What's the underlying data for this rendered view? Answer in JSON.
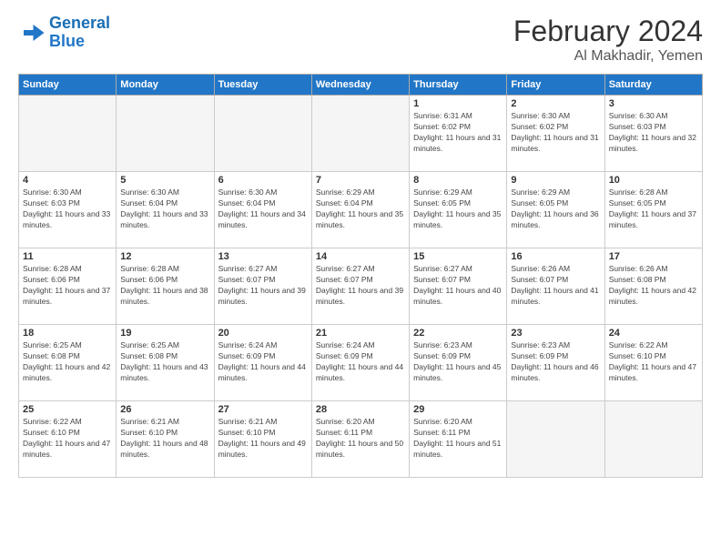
{
  "logo": {
    "line1": "General",
    "line2": "Blue"
  },
  "title": "February 2024",
  "subtitle": "Al Makhadir, Yemen",
  "days_of_week": [
    "Sunday",
    "Monday",
    "Tuesday",
    "Wednesday",
    "Thursday",
    "Friday",
    "Saturday"
  ],
  "weeks": [
    [
      {
        "day": "",
        "info": ""
      },
      {
        "day": "",
        "info": ""
      },
      {
        "day": "",
        "info": ""
      },
      {
        "day": "",
        "info": ""
      },
      {
        "day": "1",
        "info": "Sunrise: 6:31 AM\nSunset: 6:02 PM\nDaylight: 11 hours and 31 minutes."
      },
      {
        "day": "2",
        "info": "Sunrise: 6:30 AM\nSunset: 6:02 PM\nDaylight: 11 hours and 31 minutes."
      },
      {
        "day": "3",
        "info": "Sunrise: 6:30 AM\nSunset: 6:03 PM\nDaylight: 11 hours and 32 minutes."
      }
    ],
    [
      {
        "day": "4",
        "info": "Sunrise: 6:30 AM\nSunset: 6:03 PM\nDaylight: 11 hours and 33 minutes."
      },
      {
        "day": "5",
        "info": "Sunrise: 6:30 AM\nSunset: 6:04 PM\nDaylight: 11 hours and 33 minutes."
      },
      {
        "day": "6",
        "info": "Sunrise: 6:30 AM\nSunset: 6:04 PM\nDaylight: 11 hours and 34 minutes."
      },
      {
        "day": "7",
        "info": "Sunrise: 6:29 AM\nSunset: 6:04 PM\nDaylight: 11 hours and 35 minutes."
      },
      {
        "day": "8",
        "info": "Sunrise: 6:29 AM\nSunset: 6:05 PM\nDaylight: 11 hours and 35 minutes."
      },
      {
        "day": "9",
        "info": "Sunrise: 6:29 AM\nSunset: 6:05 PM\nDaylight: 11 hours and 36 minutes."
      },
      {
        "day": "10",
        "info": "Sunrise: 6:28 AM\nSunset: 6:05 PM\nDaylight: 11 hours and 37 minutes."
      }
    ],
    [
      {
        "day": "11",
        "info": "Sunrise: 6:28 AM\nSunset: 6:06 PM\nDaylight: 11 hours and 37 minutes."
      },
      {
        "day": "12",
        "info": "Sunrise: 6:28 AM\nSunset: 6:06 PM\nDaylight: 11 hours and 38 minutes."
      },
      {
        "day": "13",
        "info": "Sunrise: 6:27 AM\nSunset: 6:07 PM\nDaylight: 11 hours and 39 minutes."
      },
      {
        "day": "14",
        "info": "Sunrise: 6:27 AM\nSunset: 6:07 PM\nDaylight: 11 hours and 39 minutes."
      },
      {
        "day": "15",
        "info": "Sunrise: 6:27 AM\nSunset: 6:07 PM\nDaylight: 11 hours and 40 minutes."
      },
      {
        "day": "16",
        "info": "Sunrise: 6:26 AM\nSunset: 6:07 PM\nDaylight: 11 hours and 41 minutes."
      },
      {
        "day": "17",
        "info": "Sunrise: 6:26 AM\nSunset: 6:08 PM\nDaylight: 11 hours and 42 minutes."
      }
    ],
    [
      {
        "day": "18",
        "info": "Sunrise: 6:25 AM\nSunset: 6:08 PM\nDaylight: 11 hours and 42 minutes."
      },
      {
        "day": "19",
        "info": "Sunrise: 6:25 AM\nSunset: 6:08 PM\nDaylight: 11 hours and 43 minutes."
      },
      {
        "day": "20",
        "info": "Sunrise: 6:24 AM\nSunset: 6:09 PM\nDaylight: 11 hours and 44 minutes."
      },
      {
        "day": "21",
        "info": "Sunrise: 6:24 AM\nSunset: 6:09 PM\nDaylight: 11 hours and 44 minutes."
      },
      {
        "day": "22",
        "info": "Sunrise: 6:23 AM\nSunset: 6:09 PM\nDaylight: 11 hours and 45 minutes."
      },
      {
        "day": "23",
        "info": "Sunrise: 6:23 AM\nSunset: 6:09 PM\nDaylight: 11 hours and 46 minutes."
      },
      {
        "day": "24",
        "info": "Sunrise: 6:22 AM\nSunset: 6:10 PM\nDaylight: 11 hours and 47 minutes."
      }
    ],
    [
      {
        "day": "25",
        "info": "Sunrise: 6:22 AM\nSunset: 6:10 PM\nDaylight: 11 hours and 47 minutes."
      },
      {
        "day": "26",
        "info": "Sunrise: 6:21 AM\nSunset: 6:10 PM\nDaylight: 11 hours and 48 minutes."
      },
      {
        "day": "27",
        "info": "Sunrise: 6:21 AM\nSunset: 6:10 PM\nDaylight: 11 hours and 49 minutes."
      },
      {
        "day": "28",
        "info": "Sunrise: 6:20 AM\nSunset: 6:11 PM\nDaylight: 11 hours and 50 minutes."
      },
      {
        "day": "29",
        "info": "Sunrise: 6:20 AM\nSunset: 6:11 PM\nDaylight: 11 hours and 51 minutes."
      },
      {
        "day": "",
        "info": ""
      },
      {
        "day": "",
        "info": ""
      }
    ]
  ]
}
